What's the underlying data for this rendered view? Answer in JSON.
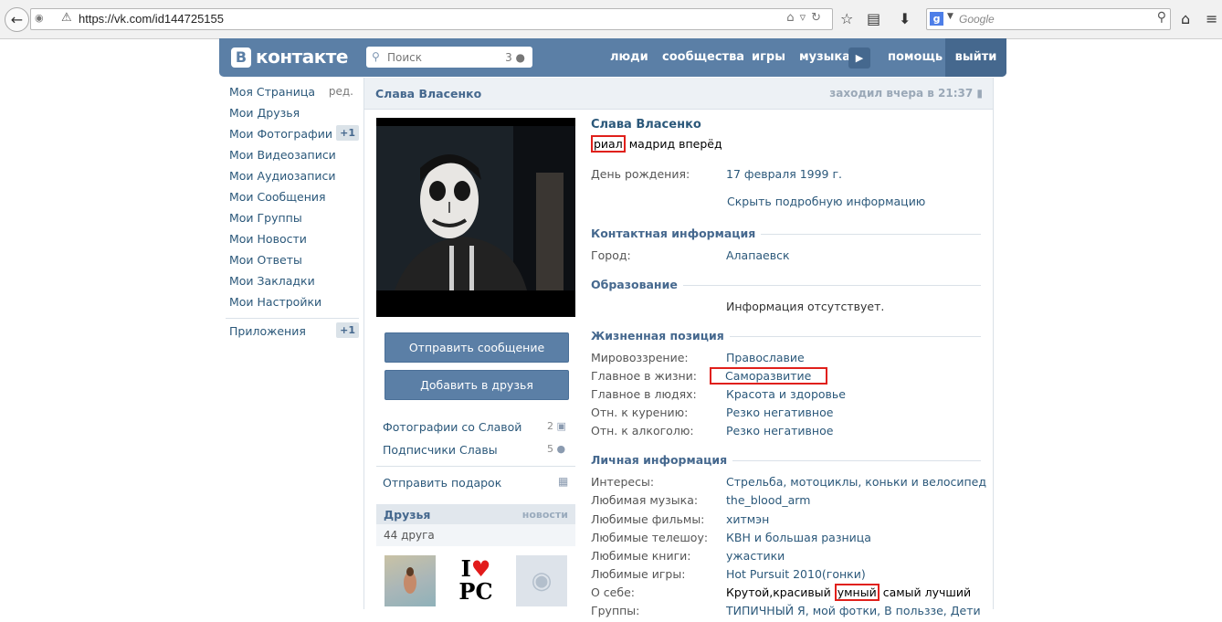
{
  "browser": {
    "url": "https://vk.com/id144725155",
    "search_placeholder": "Google",
    "search_engine_letter": "g"
  },
  "header": {
    "logo_letter": "В",
    "logo_text": "контакте",
    "search_placeholder": "Поиск",
    "search_count": "3",
    "nav": [
      "люди",
      "сообщества",
      "игры",
      "музыка"
    ],
    "help": "помощь",
    "exit": "выйти"
  },
  "left_menu": {
    "items": [
      {
        "label": "Моя Страница",
        "extra": "ред."
      },
      {
        "label": "Мои Друзья"
      },
      {
        "label": "Мои Фотографии",
        "badge": "+1"
      },
      {
        "label": "Мои Видеозаписи"
      },
      {
        "label": "Мои Аудиозаписи"
      },
      {
        "label": "Мои Сообщения"
      },
      {
        "label": "Мои Группы"
      },
      {
        "label": "Мои Новости"
      },
      {
        "label": "Мои Ответы"
      },
      {
        "label": "Мои Закладки"
      },
      {
        "label": "Мои Настройки"
      }
    ],
    "apps": {
      "label": "Приложения",
      "badge": "+1"
    }
  },
  "profile": {
    "header_name": "Слава Власенко",
    "last_seen": "заходил вчера в 21:37",
    "name": "Слава Власенко",
    "status_highlight": "риал",
    "status_rest": "мадрид вперёд",
    "birthday_label": "День рождения:",
    "birthday_value": "17 февраля 1999 г.",
    "hide_info": "Скрыть подробную информацию",
    "sections": {
      "contact": "Контактная информация",
      "education": "Образование",
      "life": "Жизненная позиция",
      "personal": "Личная информация"
    },
    "city_label": "Город:",
    "city_value": "Алапаевск",
    "education_value": "Информация отсутствует.",
    "life": [
      {
        "label": "Мировоззрение:",
        "value": "Православие"
      },
      {
        "label": "Главное в жизни:",
        "value": "Саморазвитие"
      },
      {
        "label": "Главное в людях:",
        "value": "Красота и здоровье"
      },
      {
        "label": "Отн. к курению:",
        "value": "Резко негативное"
      },
      {
        "label": "Отн. к алкоголю:",
        "value": "Резко негативное"
      }
    ],
    "personal": [
      {
        "label": "Интересы:",
        "value": "Стрельба, мотоциклы, коньки и велосипед"
      },
      {
        "label": "Любимая музыка:",
        "value": "the_blood_arm"
      },
      {
        "label": "Любимые фильмы:",
        "value": "хитмэн"
      },
      {
        "label": "Любимые телешоу:",
        "value": "КВН и большая разница"
      },
      {
        "label": "Любимые книги:",
        "value": "ужастики"
      },
      {
        "label": "Любимые игры:",
        "value": "Hot Pursuit 2010(гонки)"
      }
    ],
    "about_label": "О себе:",
    "about_before": "Крутой,красивый",
    "about_highlight": "умный",
    "about_after": "самый лучший",
    "groups_label": "Группы:",
    "groups_value": "ТИПИЧНЫЙ Я, мой фотки, В польззе, Дети"
  },
  "sidebar": {
    "send_message": "Отправить сообщение",
    "add_friend": "Добавить в друзья",
    "photos_with": "Фотографии со Славой",
    "photos_with_count": "2",
    "subscribers": "Подписчики Славы",
    "subscribers_count": "5",
    "send_gift": "Отправить подарок",
    "friends_title": "Друзья",
    "friends_news": "новости",
    "friends_count": "44 друга",
    "thumb2_text": "PC"
  },
  "colors": {
    "vk_blue": "#5b7fa6",
    "link": "#2b587a",
    "highlight": "#e0201b"
  }
}
